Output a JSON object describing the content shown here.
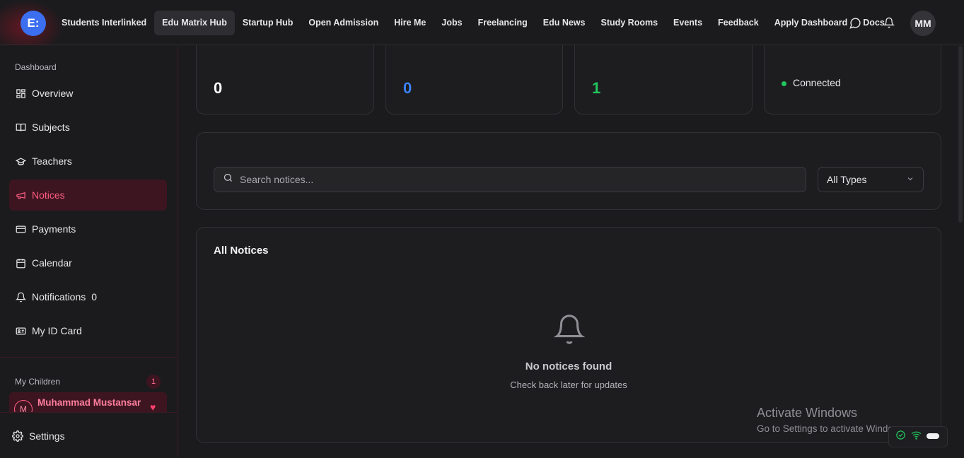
{
  "topbar": {
    "logo_text": "E:",
    "nav": [
      {
        "label": "Students Interlinked",
        "active": false
      },
      {
        "label": "Edu Matrix Hub",
        "active": true
      },
      {
        "label": "Startup Hub",
        "active": false
      },
      {
        "label": "Open Admission",
        "active": false
      },
      {
        "label": "Hire Me",
        "active": false
      },
      {
        "label": "Jobs",
        "active": false
      },
      {
        "label": "Freelancing",
        "active": false
      },
      {
        "label": "Edu News",
        "active": false
      },
      {
        "label": "Study Rooms",
        "active": false
      },
      {
        "label": "Events",
        "active": false
      },
      {
        "label": "Feedback",
        "active": false
      },
      {
        "label": "Apply Dashboard",
        "active": false
      },
      {
        "label": "Docs",
        "active": false
      }
    ],
    "icons": [
      "chat-bubble-icon",
      "bell-icon"
    ],
    "avatar_initials": "MM"
  },
  "sidebar": {
    "section_label": "Dashboard",
    "items": [
      {
        "label": "Overview",
        "icon": "grid-icon"
      },
      {
        "label": "Subjects",
        "icon": "book-open-icon"
      },
      {
        "label": "Teachers",
        "icon": "graduation-cap-icon"
      },
      {
        "label": "Notices",
        "icon": "megaphone-icon",
        "active": true
      },
      {
        "label": "Payments",
        "icon": "credit-card-icon"
      },
      {
        "label": "Calendar",
        "icon": "calendar-icon"
      },
      {
        "label": "Notifications",
        "icon": "bell-icon",
        "count": "0"
      },
      {
        "label": "My ID Card",
        "icon": "id-card-icon"
      }
    ],
    "children_label": "My Children",
    "children_count": "1",
    "child": {
      "initial": "M",
      "name": "Muhammad Mustansar"
    },
    "settings_label": "Settings"
  },
  "stats": [
    {
      "value": "0",
      "color": "#ffffff"
    },
    {
      "value": "0",
      "color": "#3b82f6"
    },
    {
      "value": "1",
      "color": "#22c55e"
    },
    {
      "value": "Connected",
      "status_color": "#22c55e"
    }
  ],
  "filters": {
    "search_placeholder": "Search notices...",
    "type_selected": "All Types"
  },
  "notices": {
    "title": "All Notices",
    "empty_title": "No notices found",
    "empty_subtitle": "Check back later for updates"
  },
  "watermark": {
    "line1": "Activate Windows",
    "line2": "Go to Settings to activate Windows."
  },
  "colors": {
    "accent": "#ff5d83",
    "brand": "#3b6ff0",
    "background": "#1b1b1d"
  }
}
